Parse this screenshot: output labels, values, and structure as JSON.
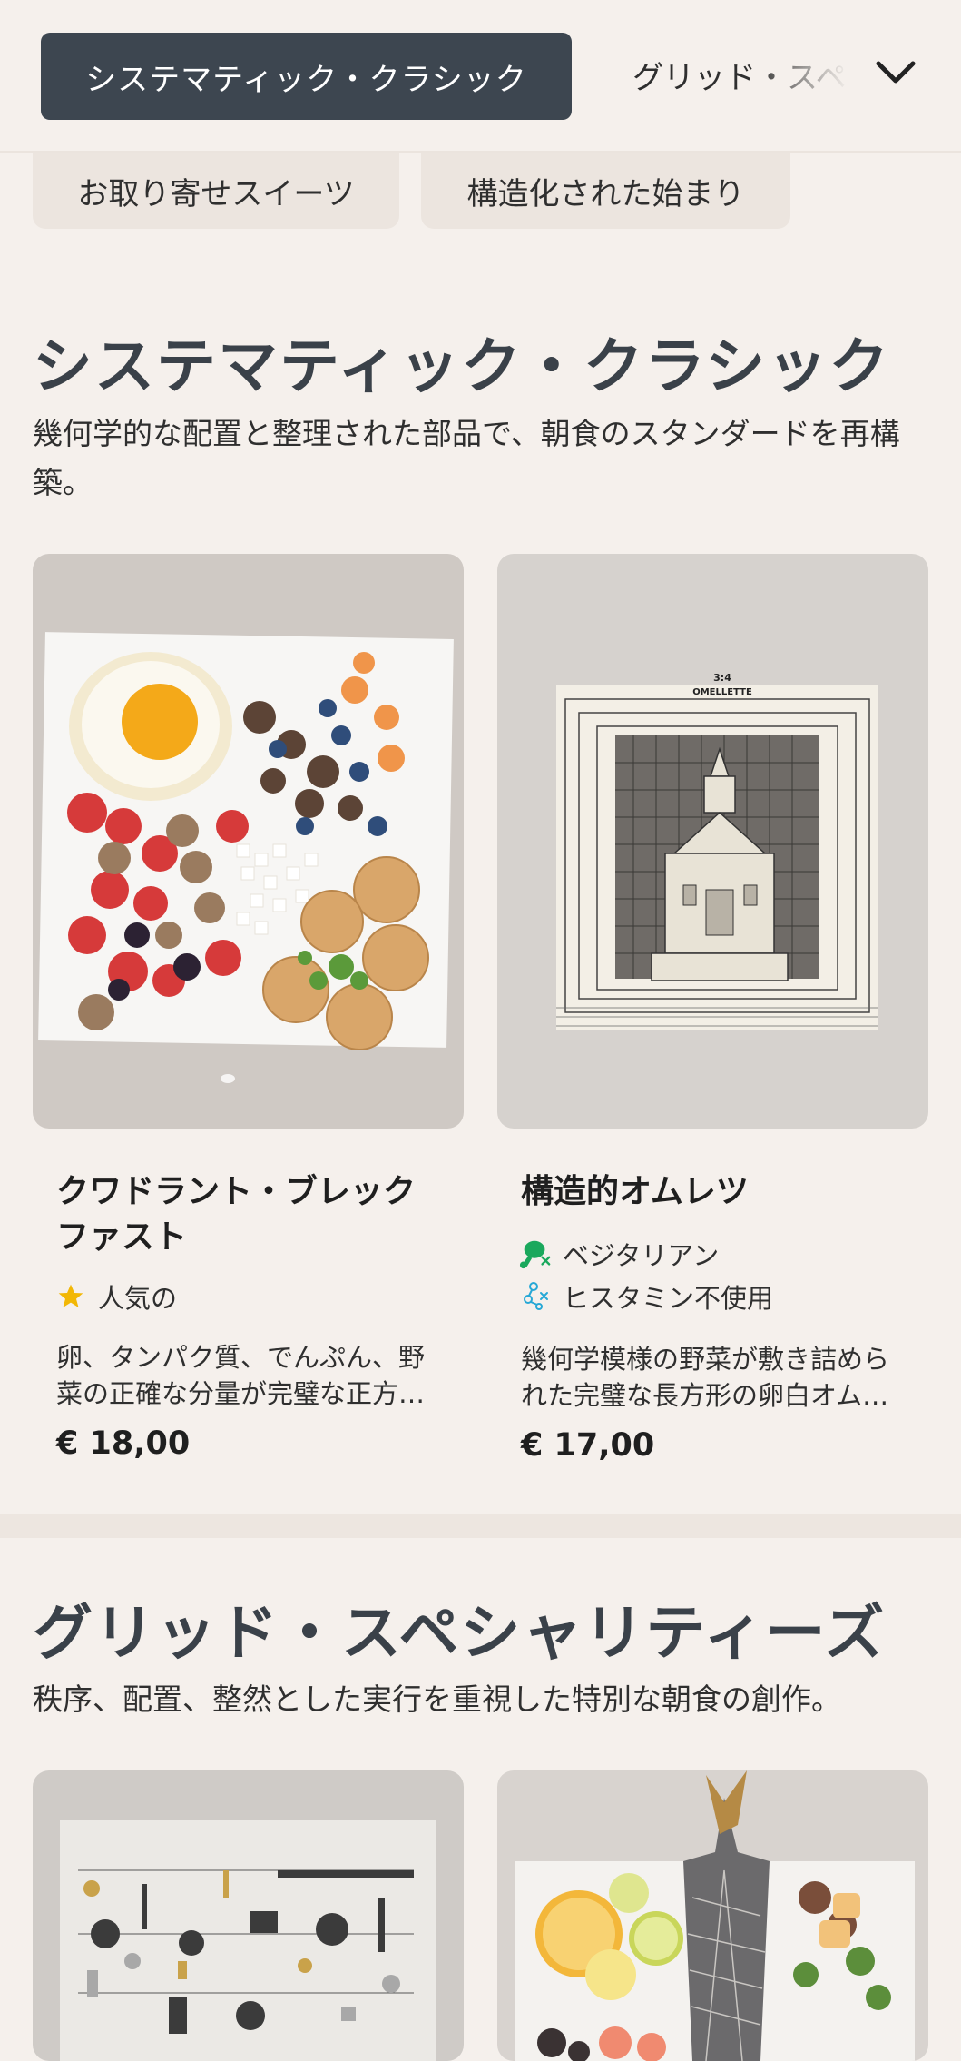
{
  "category_bar": {
    "active_label": "システマティック・クラシック",
    "next_label": "グリッド・スペシャリティーズ"
  },
  "chips": [
    "お取り寄せスイーツ",
    "構造化された始まり"
  ],
  "sections": [
    {
      "title": "システマティック・クラシック",
      "description": "幾何学的な配置と整理された部品で、朝食のスタンダードを再構築。",
      "items": [
        {
          "name": "クワドラント・ブレックファスト",
          "tags": [
            {
              "icon": "star-icon",
              "label": "人気の",
              "color": "#f2b705"
            }
          ],
          "description": "卵、タンパク質、でんぷん、野菜の正確な分量が完璧な正方…",
          "price": "€ 18,00"
        },
        {
          "name": "構造的オムレツ",
          "tags": [
            {
              "icon": "vegetarian-drumstick-icon",
              "label": "ベジタリアン",
              "color": "#1aa85c"
            },
            {
              "icon": "histamine-molecule-icon",
              "label": "ヒスタミン不使用",
              "color": "#27a8d6"
            }
          ],
          "description": "幾何学模様の野菜が敷き詰められた完璧な長方形の卵白オム…",
          "price": "€ 17,00",
          "image_text": {
            "ratio": "3:4",
            "label": "OMELLETTE"
          }
        }
      ]
    },
    {
      "title": "グリッド・スペシャリティーズ",
      "description": "秩序、配置、整然とした実行を重視した特別な朝食の創作。"
    }
  ],
  "colors": {
    "background": "#f5f0ec",
    "active_chip": "#3d4650",
    "chip": "#ece5df",
    "heading": "#3a4149"
  }
}
